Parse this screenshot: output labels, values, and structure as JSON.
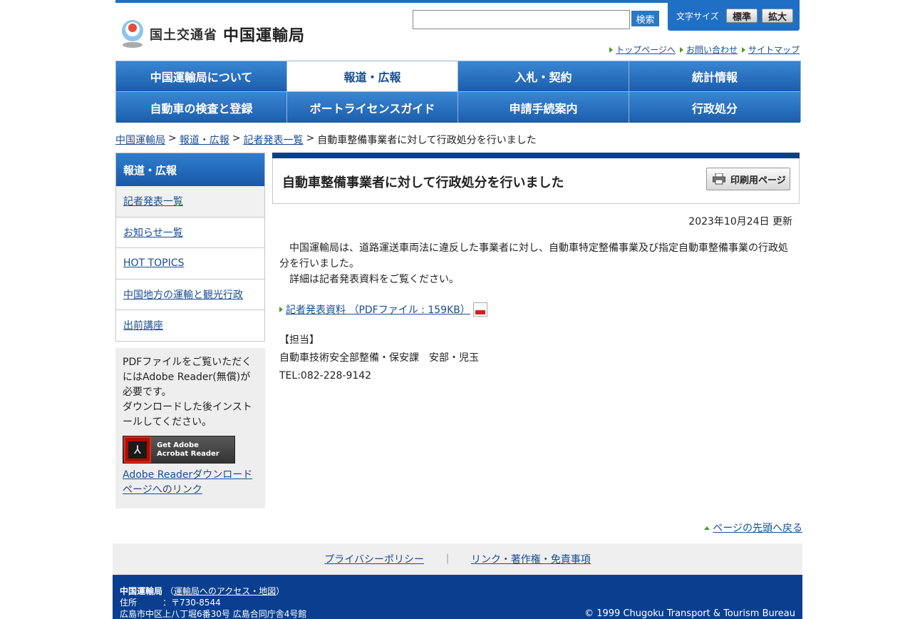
{
  "header": {
    "ministry": "国土交通省",
    "bureau": "中国運輸局",
    "search_button": "検索",
    "font_size_label": "文字サイズ",
    "font_standard": "標準",
    "font_large": "拡大",
    "util_links": [
      "トップページへ",
      "お問い合わせ",
      "サイトマップ"
    ]
  },
  "nav": {
    "items": [
      "中国運輸局について",
      "報道・広報",
      "入札・契約",
      "統計情報",
      "自動車の検査と登録",
      "ボートライセンスガイド",
      "申請手続案内",
      "行政処分"
    ],
    "active": "報道・広報"
  },
  "breadcrumb": {
    "links": [
      "中国運輸局",
      "報道・広報",
      "記者発表一覧"
    ],
    "separator": ">",
    "current": "自動車整備事業者に対して行政処分を行いました"
  },
  "sidebar": {
    "heading": "報道・広報",
    "items": [
      "記者発表一覧",
      "お知らせ一覧",
      "HOT TOPICS",
      "中国地方の運輸と観光行政",
      "出前講座"
    ]
  },
  "pdf_box": {
    "text1": "PDFファイルをご覧いただくにはAdobe Reader(無償)が必要です。",
    "text2": "ダウンロードした後インストールしてください。",
    "badge_line1": "Get Adobe",
    "badge_line2": "Acrobat Reader",
    "link": "Adobe Readerダウンロードページへのリンク"
  },
  "article": {
    "title": "自動車整備事業者に対して行政処分を行いました",
    "print_label": "印刷用ページ",
    "updated": "2023年10月24日 更新",
    "paragraph1": "　中国運輸局は、道路運送車両法に違反した事業者に対し、自動車特定整備事業及び指定自動車整備事業の行政処分を行いました。",
    "paragraph2": "　詳細は記者発表資料をご覧ください。",
    "pdf_link": "記者発表資料 （PDFファイル : 159KB）",
    "contact_heading": "【担当】",
    "contact_dept": "自動車技術安全部整備・保安課　安部・児玉",
    "contact_tel": "TEL:082-228-9142"
  },
  "to_top": "ページの先頭へ戻る",
  "footer": {
    "links": [
      "プライバシーポリシー",
      "リンク・著作権・免責事項"
    ],
    "separator": "｜",
    "org": "中国運輸局",
    "access_link": "運輸局へのアクセス・地図",
    "postal": "住所　　　：〒730-8544",
    "address": "広島市中区上八丁堀6番30号 広島合同庁舎4号館",
    "copyright": "© 1999 Chugoku Transport & Tourism Bureau"
  },
  "colors": {
    "brand_blue": "#1f6fc5",
    "dark_blue": "#0a3f8f",
    "link": "#1a4d8f",
    "green_arrow": "#4a9b2a"
  }
}
